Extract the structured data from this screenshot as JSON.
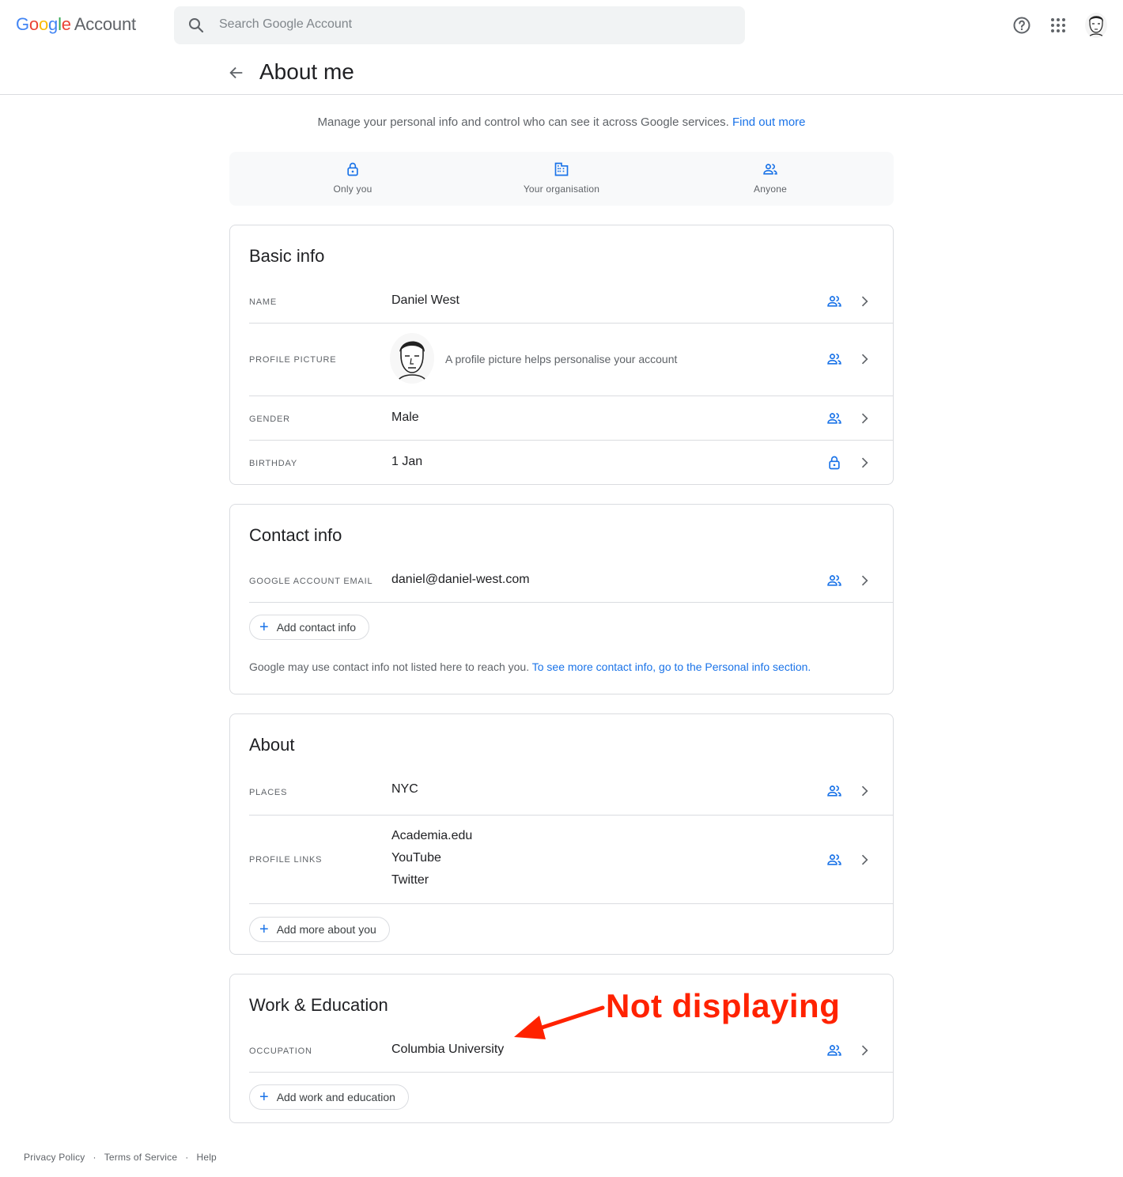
{
  "header": {
    "logo_google": "Google",
    "logo_account": "Account",
    "search_placeholder": "Search Google Account"
  },
  "page": {
    "title": "About me",
    "intro": "Manage your personal info and control who can see it across Google services.",
    "intro_link": "Find out more"
  },
  "visibility_legend": [
    {
      "label": "Only you",
      "icon": "lock-icon"
    },
    {
      "label": "Your organisation",
      "icon": "building-icon"
    },
    {
      "label": "Anyone",
      "icon": "people-icon"
    }
  ],
  "basic_info": {
    "title": "Basic info",
    "rows": [
      {
        "key": "NAME",
        "value": "Daniel West",
        "visibility": "people-icon"
      },
      {
        "key": "PROFILE PICTURE",
        "value": "A profile picture helps personalise your account",
        "visibility": "people-icon"
      },
      {
        "key": "GENDER",
        "value": "Male",
        "visibility": "people-icon"
      },
      {
        "key": "BIRTHDAY",
        "value": "1 Jan",
        "visibility": "lock-icon"
      }
    ]
  },
  "contact_info": {
    "title": "Contact info",
    "rows": [
      {
        "key": "GOOGLE ACCOUNT EMAIL",
        "value": "daniel@daniel-west.com",
        "visibility": "people-icon"
      }
    ],
    "add_label": "Add contact info",
    "note": "Google may use contact info not listed here to reach you.",
    "note_link": "To see more contact info, go to the Personal info section."
  },
  "about": {
    "title": "About",
    "rows": [
      {
        "key": "PLACES",
        "value": "NYC",
        "visibility": "people-icon"
      },
      {
        "key": "PROFILE LINKS",
        "values": [
          "Academia.edu",
          "YouTube",
          "Twitter"
        ],
        "visibility": "people-icon"
      }
    ],
    "add_label": "Add more about you"
  },
  "work_education": {
    "title": "Work & Education",
    "rows": [
      {
        "key": "OCCUPATION",
        "value": "Columbia University",
        "visibility": "people-icon"
      }
    ],
    "add_label": "Add work and education"
  },
  "annotation": {
    "text": "Not displaying",
    "color": "#ff2200"
  },
  "footer": {
    "links": [
      "Privacy Policy",
      "Terms of Service",
      "Help"
    ]
  },
  "colors": {
    "accent": "#1a73e8",
    "border": "#dadce0",
    "muted_text": "#5f6368"
  }
}
